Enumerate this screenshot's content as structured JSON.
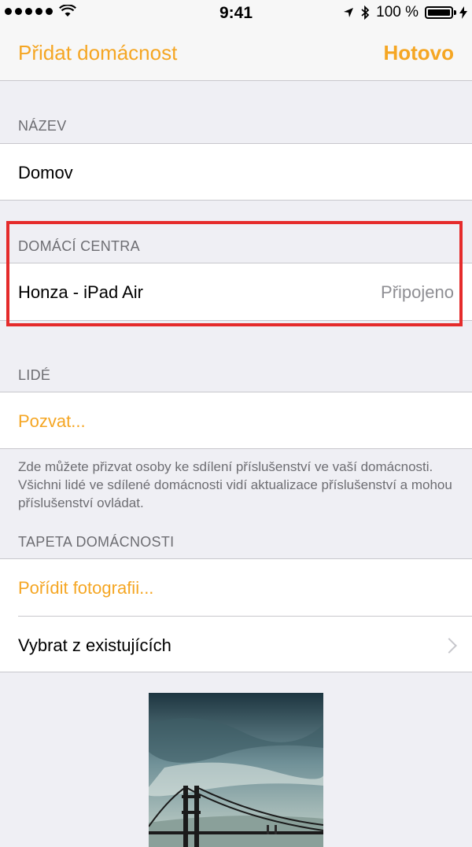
{
  "status_bar": {
    "time": "9:41",
    "battery": "100 %",
    "icons": [
      "signal-dots-icon",
      "wifi-icon",
      "location-arrow-icon",
      "bluetooth-icon",
      "battery-icon",
      "charging-bolt-icon"
    ]
  },
  "nav": {
    "left_label": "Přidat domácnost",
    "right_label": "Hotovo"
  },
  "sections": {
    "name": {
      "header": "NÁZEV",
      "value": "Domov"
    },
    "hubs": {
      "header": "DOMÁCÍ CENTRA",
      "device": "Honza - iPad Air",
      "status": "Připojeno"
    },
    "people": {
      "header": "LIDÉ",
      "invite_label": "Pozvat...",
      "footer": "Zde můžete přizvat osoby ke sdílení příslušenství ve vaší domácnosti. Všichni lidé ve sdílené domácnosti vidí aktualizace příslušenství a mohou příslušenství ovládat."
    },
    "wallpaper": {
      "header": "TAPETA DOMÁCNOSTI",
      "take_photo_label": "Pořídit fotografii...",
      "choose_existing_label": "Vybrat z existujících"
    }
  },
  "colors": {
    "accent": "#f5a623",
    "highlight": "#e52b2b",
    "background": "#efeff4"
  }
}
